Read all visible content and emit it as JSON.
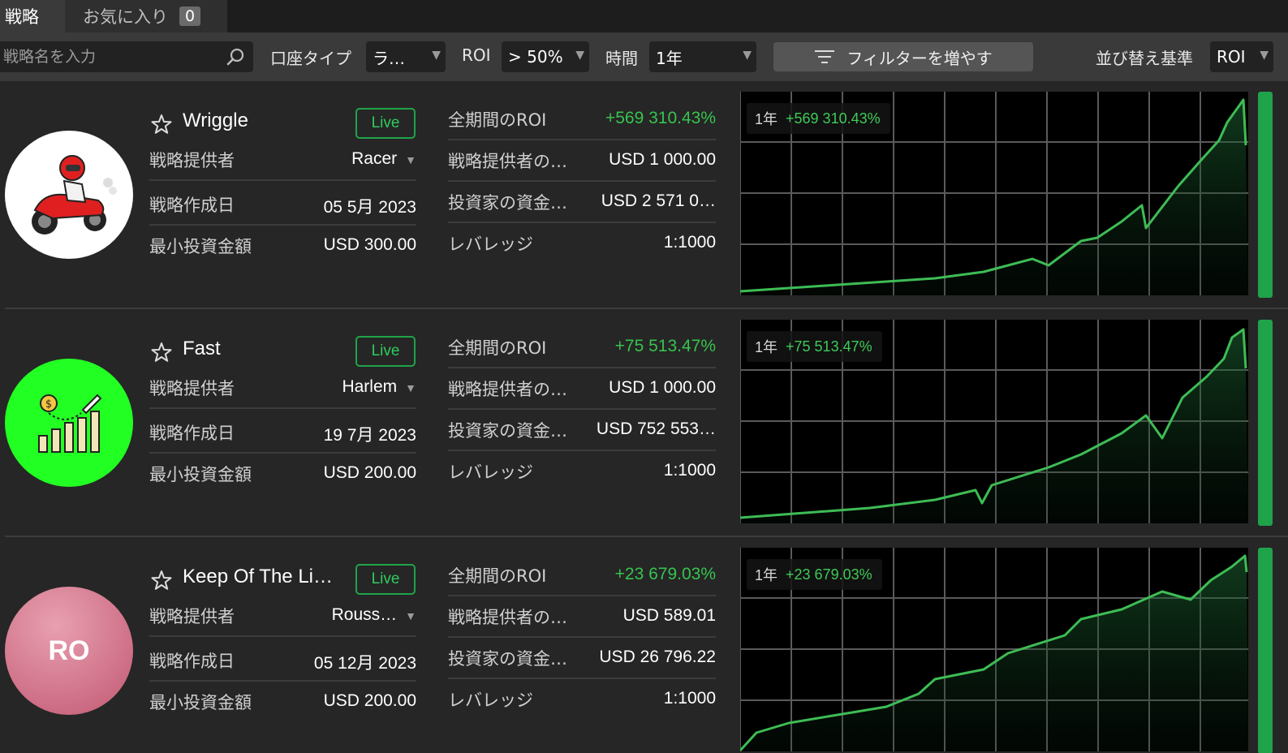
{
  "tabs": {
    "strategies": "戦略",
    "favorites": "お気に入り",
    "favorites_count": "0"
  },
  "filters": {
    "search_placeholder": "戦略名を入力",
    "account_type_label": "口座タイプ",
    "account_type_value": "ラ…",
    "roi_label": "ROI",
    "roi_value": "> 50%",
    "time_label": "時間",
    "time_value": "1年",
    "more_filters": "フィルターを増やす",
    "sort_label": "並び替え基準",
    "sort_value": "ROI"
  },
  "labels": {
    "provider": "戦略提供者",
    "created": "戦略作成日",
    "min_invest": "最小投資金額",
    "roi_all": "全期間のROI",
    "provider_funds": "戦略提供者の…",
    "investor_funds": "投資家の資金…",
    "leverage": "レバレッジ",
    "live": "Live"
  },
  "colors": {
    "accent_green": "#37c34f",
    "live_border": "#1fa34a",
    "background": "#262626"
  },
  "strategies": [
    {
      "name": "Wriggle",
      "provider": "Racer",
      "created": "05 5月 2023",
      "min_invest": "USD 300.00",
      "roi_all": "+569 310.43%",
      "provider_funds": "USD 1 000.00",
      "investor_funds": "USD 2 571 0…",
      "leverage": "1:1000",
      "chart_period": "1年",
      "chart_roi": "+569 310.43%",
      "avatar_icon": "motorcycle-racer-icon",
      "avatar_bg": "#ffffff"
    },
    {
      "name": "Fast",
      "provider": "Harlem",
      "created": "19 7月 2023",
      "min_invest": "USD 200.00",
      "roi_all": "+75 513.47%",
      "provider_funds": "USD 1 000.00",
      "investor_funds": "USD 752 553…",
      "leverage": "1:1000",
      "chart_period": "1年",
      "chart_roi": "+75 513.47%",
      "avatar_icon": "rocket-growth-chart-icon",
      "avatar_bg": "#22ff22"
    },
    {
      "name": "Keep Of The Li…",
      "provider": "Rouss…",
      "created": "05 12月 2023",
      "min_invest": "USD 200.00",
      "roi_all": "+23 679.03%",
      "provider_funds": "USD 589.01",
      "investor_funds": "USD 26 796.22",
      "leverage": "1:1000",
      "chart_period": "1年",
      "chart_roi": "+23 679.03%",
      "avatar_text": "RO",
      "avatar_bg": "#d87a8e"
    }
  ]
}
